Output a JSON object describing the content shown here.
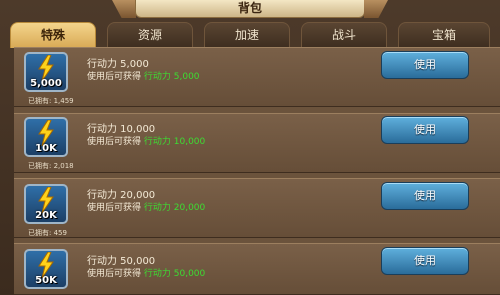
{
  "title": "背包",
  "tabs": [
    {
      "label": "特殊",
      "active": true
    },
    {
      "label": "资源",
      "active": false
    },
    {
      "label": "加速",
      "active": false
    },
    {
      "label": "战斗",
      "active": false
    },
    {
      "label": "宝箱",
      "active": false
    }
  ],
  "items": [
    {
      "icon": "lightning-icon",
      "icon_value": "5,000",
      "owned": "已拥有: 1,459",
      "name": "行动力 5,000",
      "desc_prefix": "使用后可获得",
      "desc_value": "行动力 5,000",
      "button": "使用"
    },
    {
      "icon": "lightning-icon",
      "icon_value": "10K",
      "owned": "已拥有: 2,018",
      "name": "行动力 10,000",
      "desc_prefix": "使用后可获得",
      "desc_value": "行动力 10,000",
      "button": "使用"
    },
    {
      "icon": "lightning-icon",
      "icon_value": "20K",
      "owned": "已拥有: 459",
      "name": "行动力 20,000",
      "desc_prefix": "使用后可获得",
      "desc_value": "行动力 20,000",
      "button": "使用"
    },
    {
      "icon": "lightning-icon",
      "icon_value": "50K",
      "owned": "",
      "name": "行动力 50,000",
      "desc_prefix": "使用后可获得",
      "desc_value": "行动力 50,000",
      "button": "使用"
    }
  ],
  "colors": {
    "highlight": "#3ddc32",
    "button": "#3b88bd",
    "active_tab": "#e6bd6c"
  }
}
